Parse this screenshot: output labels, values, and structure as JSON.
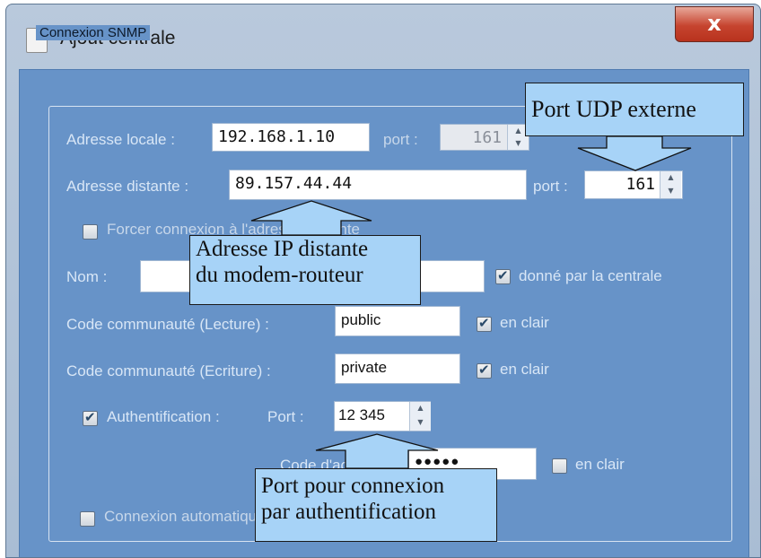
{
  "window": {
    "title": "Ajout centrale",
    "close_label": "x"
  },
  "group": {
    "title": "Connexion SNMP"
  },
  "local": {
    "label": "Adresse locale :",
    "ip": "192.168.1.10",
    "port_label": "port :",
    "port": "161"
  },
  "remote": {
    "label": "Adresse distante :",
    "ip": "89.157.44.44",
    "port_label": "port :",
    "port": "161"
  },
  "force": {
    "label": "Forcer connexion à l'adresse distante",
    "checked": false
  },
  "name": {
    "label": "Nom :",
    "value": "",
    "given_label": "donné par la centrale",
    "given_checked": true
  },
  "community_read": {
    "label": "Code communauté (Lecture) :",
    "value": "public",
    "clear_label": "en clair",
    "clear_checked": true
  },
  "community_write": {
    "label": "Code communauté (Ecriture) :",
    "value": "private",
    "clear_label": "en clair",
    "clear_checked": true
  },
  "auth": {
    "label": "Authentification :",
    "checked": true,
    "port_label": "Port :",
    "port": "12 345"
  },
  "auth_code": {
    "label": "Code d'accès :",
    "value": "●●●●●",
    "clear_label": "en clair",
    "clear_checked": false
  },
  "auto": {
    "label": "Connexion automatique",
    "checked": false
  },
  "annotations": {
    "udp": "Port UDP externe",
    "ip_line1": "Adresse IP distante",
    "ip_line2": "du modem-routeur",
    "auth_line1": "Port pour connexion",
    "auth_line2": "par authentification"
  },
  "colors": {
    "client_bg": "#6793c8",
    "callout_bg": "#a7d3f7"
  }
}
